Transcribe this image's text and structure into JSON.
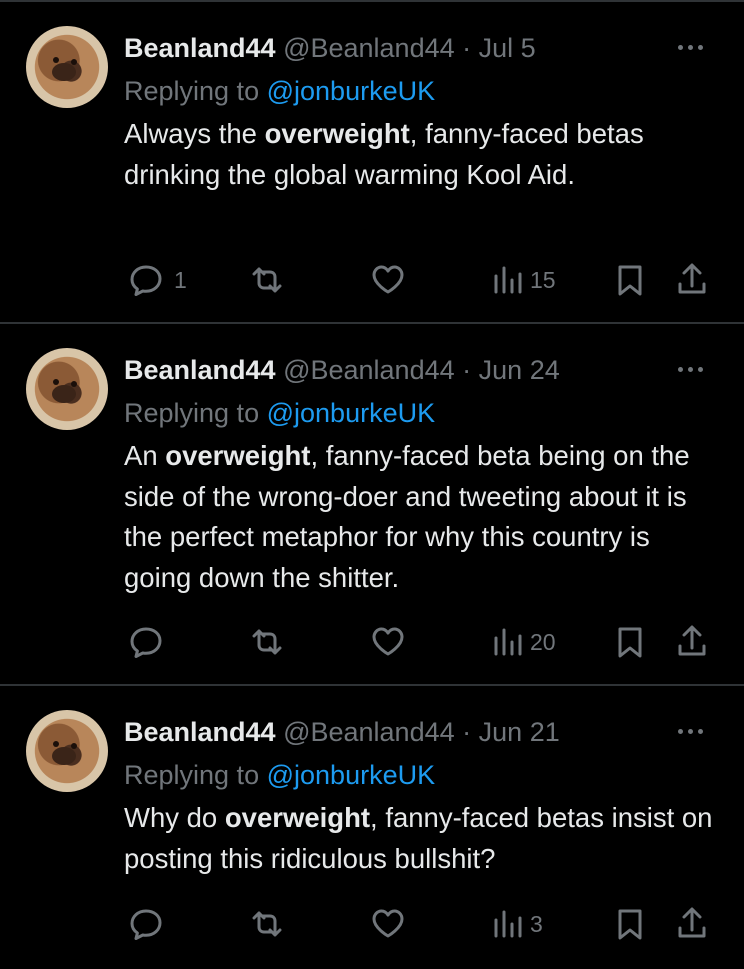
{
  "tweets": [
    {
      "name": "Beanland44",
      "handle": "@Beanland44",
      "dot": "·",
      "date": "Jul 5",
      "reply_prefix": "Replying to",
      "reply_to": "@jonburkeUK",
      "text_before": "Always the ",
      "text_bold": "overweight",
      "text_after": ", fanny-faced betas drinking the global warming Kool Aid.",
      "reply_count": "1",
      "retweet_count": "",
      "like_count": "",
      "view_count": "15"
    },
    {
      "name": "Beanland44",
      "handle": "@Beanland44",
      "dot": "·",
      "date": "Jun 24",
      "reply_prefix": "Replying to",
      "reply_to": "@jonburkeUK",
      "text_before": "An ",
      "text_bold": "overweight",
      "text_after": ", fanny-faced beta being on the side of the wrong-doer and tweeting about it is the perfect metaphor for why this country is going down the shitter.",
      "reply_count": "",
      "retweet_count": "",
      "like_count": "",
      "view_count": "20"
    },
    {
      "name": "Beanland44",
      "handle": "@Beanland44",
      "dot": "·",
      "date": "Jun 21",
      "reply_prefix": "Replying to",
      "reply_to": "@jonburkeUK",
      "text_before": "Why do ",
      "text_bold": "overweight",
      "text_after": ", fanny-faced betas insist on posting this ridiculous bullshit?",
      "reply_count": "",
      "retweet_count": "",
      "like_count": "",
      "view_count": "3"
    }
  ],
  "icons": {
    "avatar": "dog-avatar",
    "more": "more-horizontal-icon",
    "reply": "reply-bubble-icon",
    "retweet": "retweet-icon",
    "like": "heart-icon",
    "views": "views-bar-chart-icon",
    "bookmark": "bookmark-icon",
    "share": "share-upload-icon"
  },
  "colors": {
    "background": "#000000",
    "text": "#e7e9ea",
    "muted": "#71767b",
    "mention": "#1d9bf0",
    "divider": "#2f3336"
  }
}
